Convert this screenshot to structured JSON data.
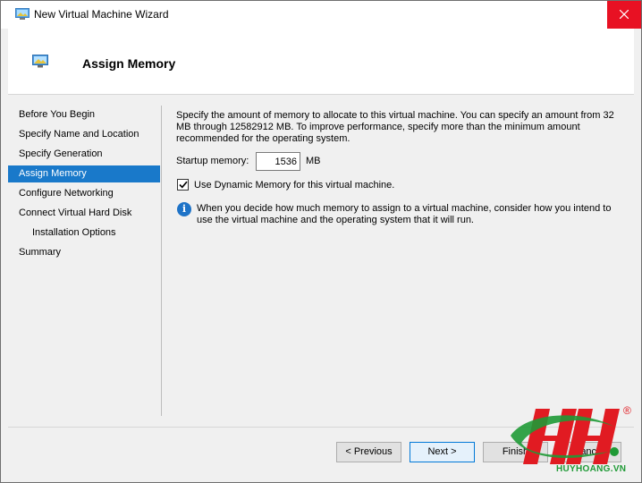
{
  "window": {
    "title": "New Virtual Machine Wizard",
    "icon": "vm-wizard-icon",
    "close_icon": "close-icon"
  },
  "header": {
    "title": "Assign Memory",
    "icon": "monitor-icon"
  },
  "nav": {
    "items": [
      {
        "label": "Before You Begin",
        "active": false,
        "indent": false
      },
      {
        "label": "Specify Name and Location",
        "active": false,
        "indent": false
      },
      {
        "label": "Specify Generation",
        "active": false,
        "indent": false
      },
      {
        "label": "Assign Memory",
        "active": true,
        "indent": false
      },
      {
        "label": "Configure Networking",
        "active": false,
        "indent": false
      },
      {
        "label": "Connect Virtual Hard Disk",
        "active": false,
        "indent": false
      },
      {
        "label": "Installation Options",
        "active": false,
        "indent": true
      },
      {
        "label": "Summary",
        "active": false,
        "indent": false
      }
    ]
  },
  "main": {
    "description": "Specify the amount of memory to allocate to this virtual machine. You can specify an amount from 32 MB through 12582912 MB. To improve performance, specify more than the minimum amount recommended for the operating system.",
    "startup_memory_label": "Startup memory:",
    "startup_memory_value": "1536",
    "startup_memory_unit": "MB",
    "dynamic_memory_label": "Use Dynamic Memory for this virtual machine.",
    "dynamic_memory_checked": true,
    "info_icon": "info-icon",
    "info_text": "When you decide how much memory to assign to a virtual machine, consider how you intend to use the virtual machine and the operating system that it will run."
  },
  "buttons": {
    "previous": "< Previous",
    "next": "Next >",
    "finish": "Finish",
    "cancel": "Cancel"
  },
  "watermark": {
    "text": "HUYHOANG.VN",
    "registered": "®"
  },
  "colors": {
    "accent": "#1979ca",
    "close": "#e81123",
    "info": "#1e73c7",
    "watermark_red": "#e11b22",
    "watermark_green": "#1f9a36"
  }
}
